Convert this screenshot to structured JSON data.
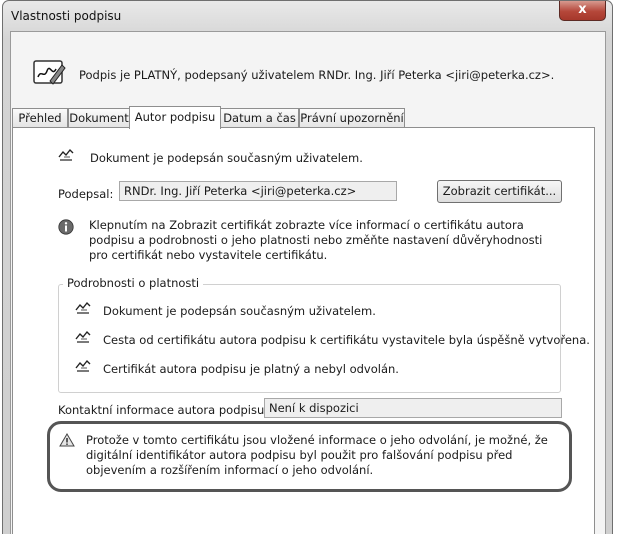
{
  "window": {
    "title": "Vlastnosti podpisu",
    "close_symbol": "x"
  },
  "header": {
    "status_icon": "signature-pen-icon",
    "status_text": "Podpis je PLATNÝ, podepsaný uživatelem RNDr. Ing. Jiří Peterka <jiri@peterka.cz>."
  },
  "tabs": [
    {
      "label": "Přehled",
      "active": false
    },
    {
      "label": "Dokument",
      "active": false
    },
    {
      "label": "Autor podpisu",
      "active": true
    },
    {
      "label": "Datum a čas",
      "active": false
    },
    {
      "label": "Právní upozornění",
      "active": false
    }
  ],
  "panel": {
    "signed_by_current_user": "Dokument je podepsán současným uživatelem.",
    "signer_label": "Podepsal:",
    "signer_value": "RNDr. Ing. Jiří Peterka <jiri@peterka.cz>",
    "show_certificate_button": "Zobrazit certifikát...",
    "info_icon": "info-icon",
    "info_text": "Klepnutím na Zobrazit certifikát zobrazte více informací o certifikátu autora podpisu a podrobnosti o jeho platnosti nebo změňte nastavení důvěryhodnosti pro certifikát nebo vystavitele certifikátu.",
    "validity": {
      "legend": "Podrobnosti o platnosti",
      "items": [
        "Dokument je podepsán současným uživatelem.",
        "Cesta od certifikátu autora podpisu k certifikátu vystavitele byla úspěšně vytvořena.",
        "Certifikát autora podpisu je platný a nebyl odvolán."
      ]
    },
    "contact_label": "Kontaktní informace autora podpisu:",
    "contact_value": "Není k dispozici",
    "warning_icon": "warning-icon",
    "warning_text": "Protože v tomto certifikátu jsou vložené informace o jeho odvolání, je možné, že digitální identifikátor autora podpisu byl použit pro falšování podpisu před objevením a rozšířením informací o jeho odvolání."
  }
}
